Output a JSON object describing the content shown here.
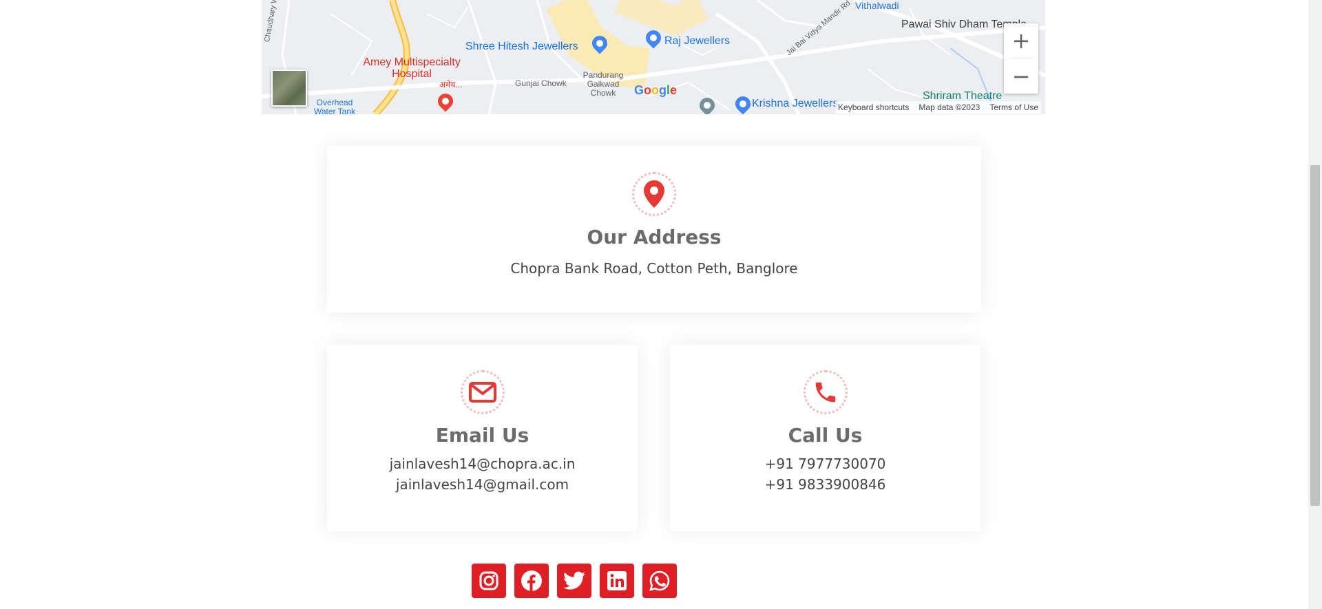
{
  "map": {
    "labels": {
      "hospital": "Amey Multispecialty Hospital",
      "hospital_marathi": "अमेय...",
      "shree_hitesh": "Shree Hitesh Jewellers",
      "raj": "Raj Jewellers",
      "pawai": "Pawai Shiv Dham Temple",
      "shriram": "Shriram Theatre",
      "krishna": "Krishna Jewellers",
      "gunjai": "Gunjai Chowk",
      "pandurang": "Pandurang Gaikwad Chowk",
      "overhead": "Overhead Water Tank",
      "vithalwadi": "Vithalwadi",
      "chaudhary_road": "Chaudhary Wadi Rd",
      "jai_bai_road": "Jai Bai Vidya Mandir Rd"
    },
    "google_logo": "Google",
    "attribution": {
      "shortcuts": "Keyboard shortcuts",
      "map_data": "Map data ©2023",
      "terms": "Terms of Use"
    },
    "zoom_in": "+",
    "zoom_out": "−"
  },
  "address": {
    "icon": "map-pin-icon",
    "title": "Our Address",
    "text": "Chopra Bank Road, Cotton Peth, Banglore"
  },
  "email": {
    "icon": "envelope-icon",
    "title": "Email Us",
    "lines": [
      "jainlavesh14@chopra.ac.in",
      "jainlavesh14@gmail.com"
    ]
  },
  "phone": {
    "icon": "phone-icon",
    "title": "Call Us",
    "lines": [
      "+91 7977730070",
      "+91 9833900846"
    ]
  },
  "social": [
    "instagram-icon",
    "facebook-icon",
    "twitter-icon",
    "linkedin-icon",
    "whatsapp-icon"
  ],
  "colors": {
    "accent": "#e01e26",
    "icon_red": "#e53935",
    "ring": "#f5b8ba"
  }
}
